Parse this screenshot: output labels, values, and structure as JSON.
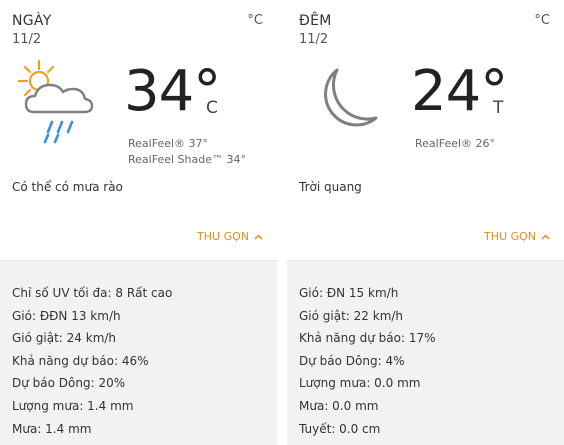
{
  "day": {
    "period": "NGÀY",
    "date": "11/2",
    "unit": "°C",
    "temp": "34°",
    "temp_unit": "C",
    "realfeel": "RealFeel® 37°",
    "realfeel_shade": "RealFeel Shade™ 34°",
    "condition": "Có thể có mưa rào",
    "icon": "partly-sunny-showers-icon",
    "collapse_label": "THU GỌN",
    "details": [
      "Chỉ số UV tối đa: 8 Rất cao",
      "Gió: ĐĐN 13 km/h",
      "Gió giật: 24 km/h",
      "Khả năng dự báo: 46%",
      "Dự báo Dông: 20%",
      "Lượng mưa: 1.4 mm",
      "Mưa: 1.4 mm"
    ]
  },
  "night": {
    "period": "ĐÊM",
    "date": "11/2",
    "unit": "°C",
    "temp": "24°",
    "temp_unit": "T",
    "realfeel": "RealFeel® 26°",
    "condition": "Trời quang",
    "icon": "crescent-moon-icon",
    "collapse_label": "THU GỌN",
    "details": [
      "Gió: ĐN 15 km/h",
      "Gió giật: 22 km/h",
      "Khả năng dự báo: 17%",
      "Dự báo Dông: 4%",
      "Lượng mưa: 0.0 mm",
      "Mưa: 0.0 mm",
      "Tuyết: 0.0 cm"
    ]
  },
  "colors": {
    "accent": "#e08c1e",
    "sun": "#f0a020",
    "rain": "#3a8fd6",
    "cloud": "#7f7f7f"
  }
}
